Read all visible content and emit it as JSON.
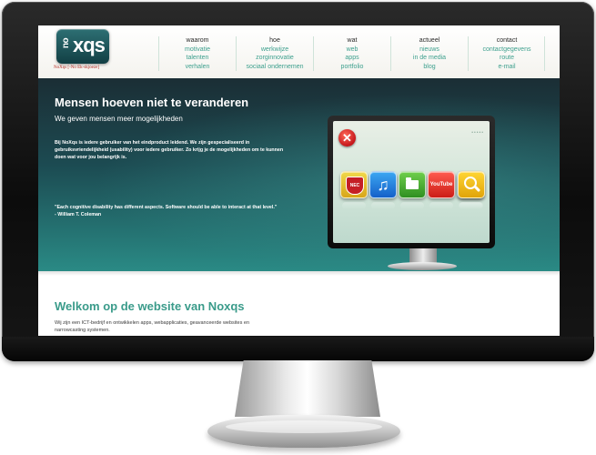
{
  "logo": {
    "prefix": "no",
    "name": "xqs",
    "tagline": "NoXqs [-No Ek-skjoeze]"
  },
  "nav": [
    {
      "heading": "waarom",
      "links": [
        "motivatie",
        "talenten",
        "verhalen"
      ]
    },
    {
      "heading": "hoe",
      "links": [
        "werkwijze",
        "zorginnovatie",
        "sociaal ondernemen"
      ]
    },
    {
      "heading": "wat",
      "links": [
        "web",
        "apps",
        "portfolio"
      ]
    },
    {
      "heading": "actueel",
      "links": [
        "nieuws",
        "in de media",
        "blog"
      ]
    },
    {
      "heading": "contact",
      "links": [
        "contactgegevens",
        "route",
        "e-mail"
      ]
    }
  ],
  "hero": {
    "title": "Mensen hoeven niet te veranderen",
    "subtitle": "We geven mensen meer mogelijkheden",
    "intro": "Bij NoXqs is iedere gebruiker van het eindproduct leidend. We zijn gespecialiseerd in gebruiksvriendelijkheid (usability) voor iedere gebruiker. Zo krijg je de mogelijkheden om te kunnen doen wat voor jou belangrijk is.",
    "quote": "\"Each cognitive disability has different aspects. Software should be able to interact at that level.\"",
    "quote_author": "- William T. Coleman"
  },
  "device": {
    "close_symbol": "✕",
    "app_icons": [
      {
        "name": "nec-icon",
        "label": "NEC"
      },
      {
        "name": "music-icon",
        "label": "♫"
      },
      {
        "name": "folder-icon",
        "label": ""
      },
      {
        "name": "youtube-icon",
        "label": "YouTube"
      },
      {
        "name": "camera-icon",
        "label": ""
      },
      {
        "name": "search-icon",
        "label": ""
      }
    ]
  },
  "welcome": {
    "title": "Welkom op de website van Noxqs",
    "text": "Wij zijn een ICT-bedrijf en ontwikkelen apps, webapplicaties, geavanceerde websites en narrowcasting systemen."
  },
  "colors": {
    "accent": "#3ea08e",
    "hero_dark": "#1b2e35",
    "hero_teal": "#2a8a85",
    "logo_red": "#b3261e"
  }
}
